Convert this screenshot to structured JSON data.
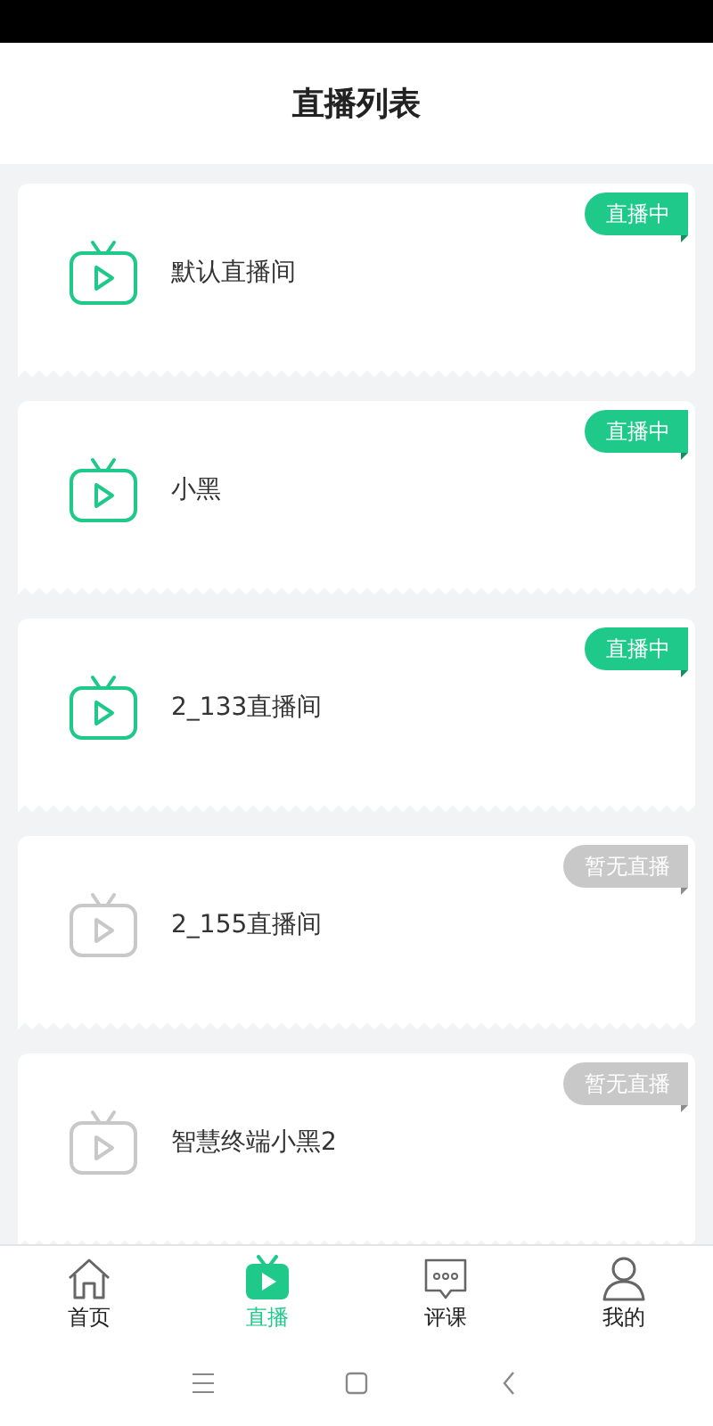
{
  "header": {
    "title": "直播列表"
  },
  "rooms": [
    {
      "name": "默认直播间",
      "status": "直播中",
      "live": true
    },
    {
      "name": "小黑",
      "status": "直播中",
      "live": true
    },
    {
      "name": "2_133直播间",
      "status": "直播中",
      "live": true
    },
    {
      "name": "2_155直播间",
      "status": "暂无直播",
      "live": false
    },
    {
      "name": "智慧终端小黑2",
      "status": "暂无直播",
      "live": false
    }
  ],
  "tab_bar": [
    {
      "label": "首页",
      "selected": false
    },
    {
      "label": "直播",
      "selected": true
    },
    {
      "label": "评课",
      "selected": false
    },
    {
      "label": "我的",
      "selected": false
    }
  ]
}
